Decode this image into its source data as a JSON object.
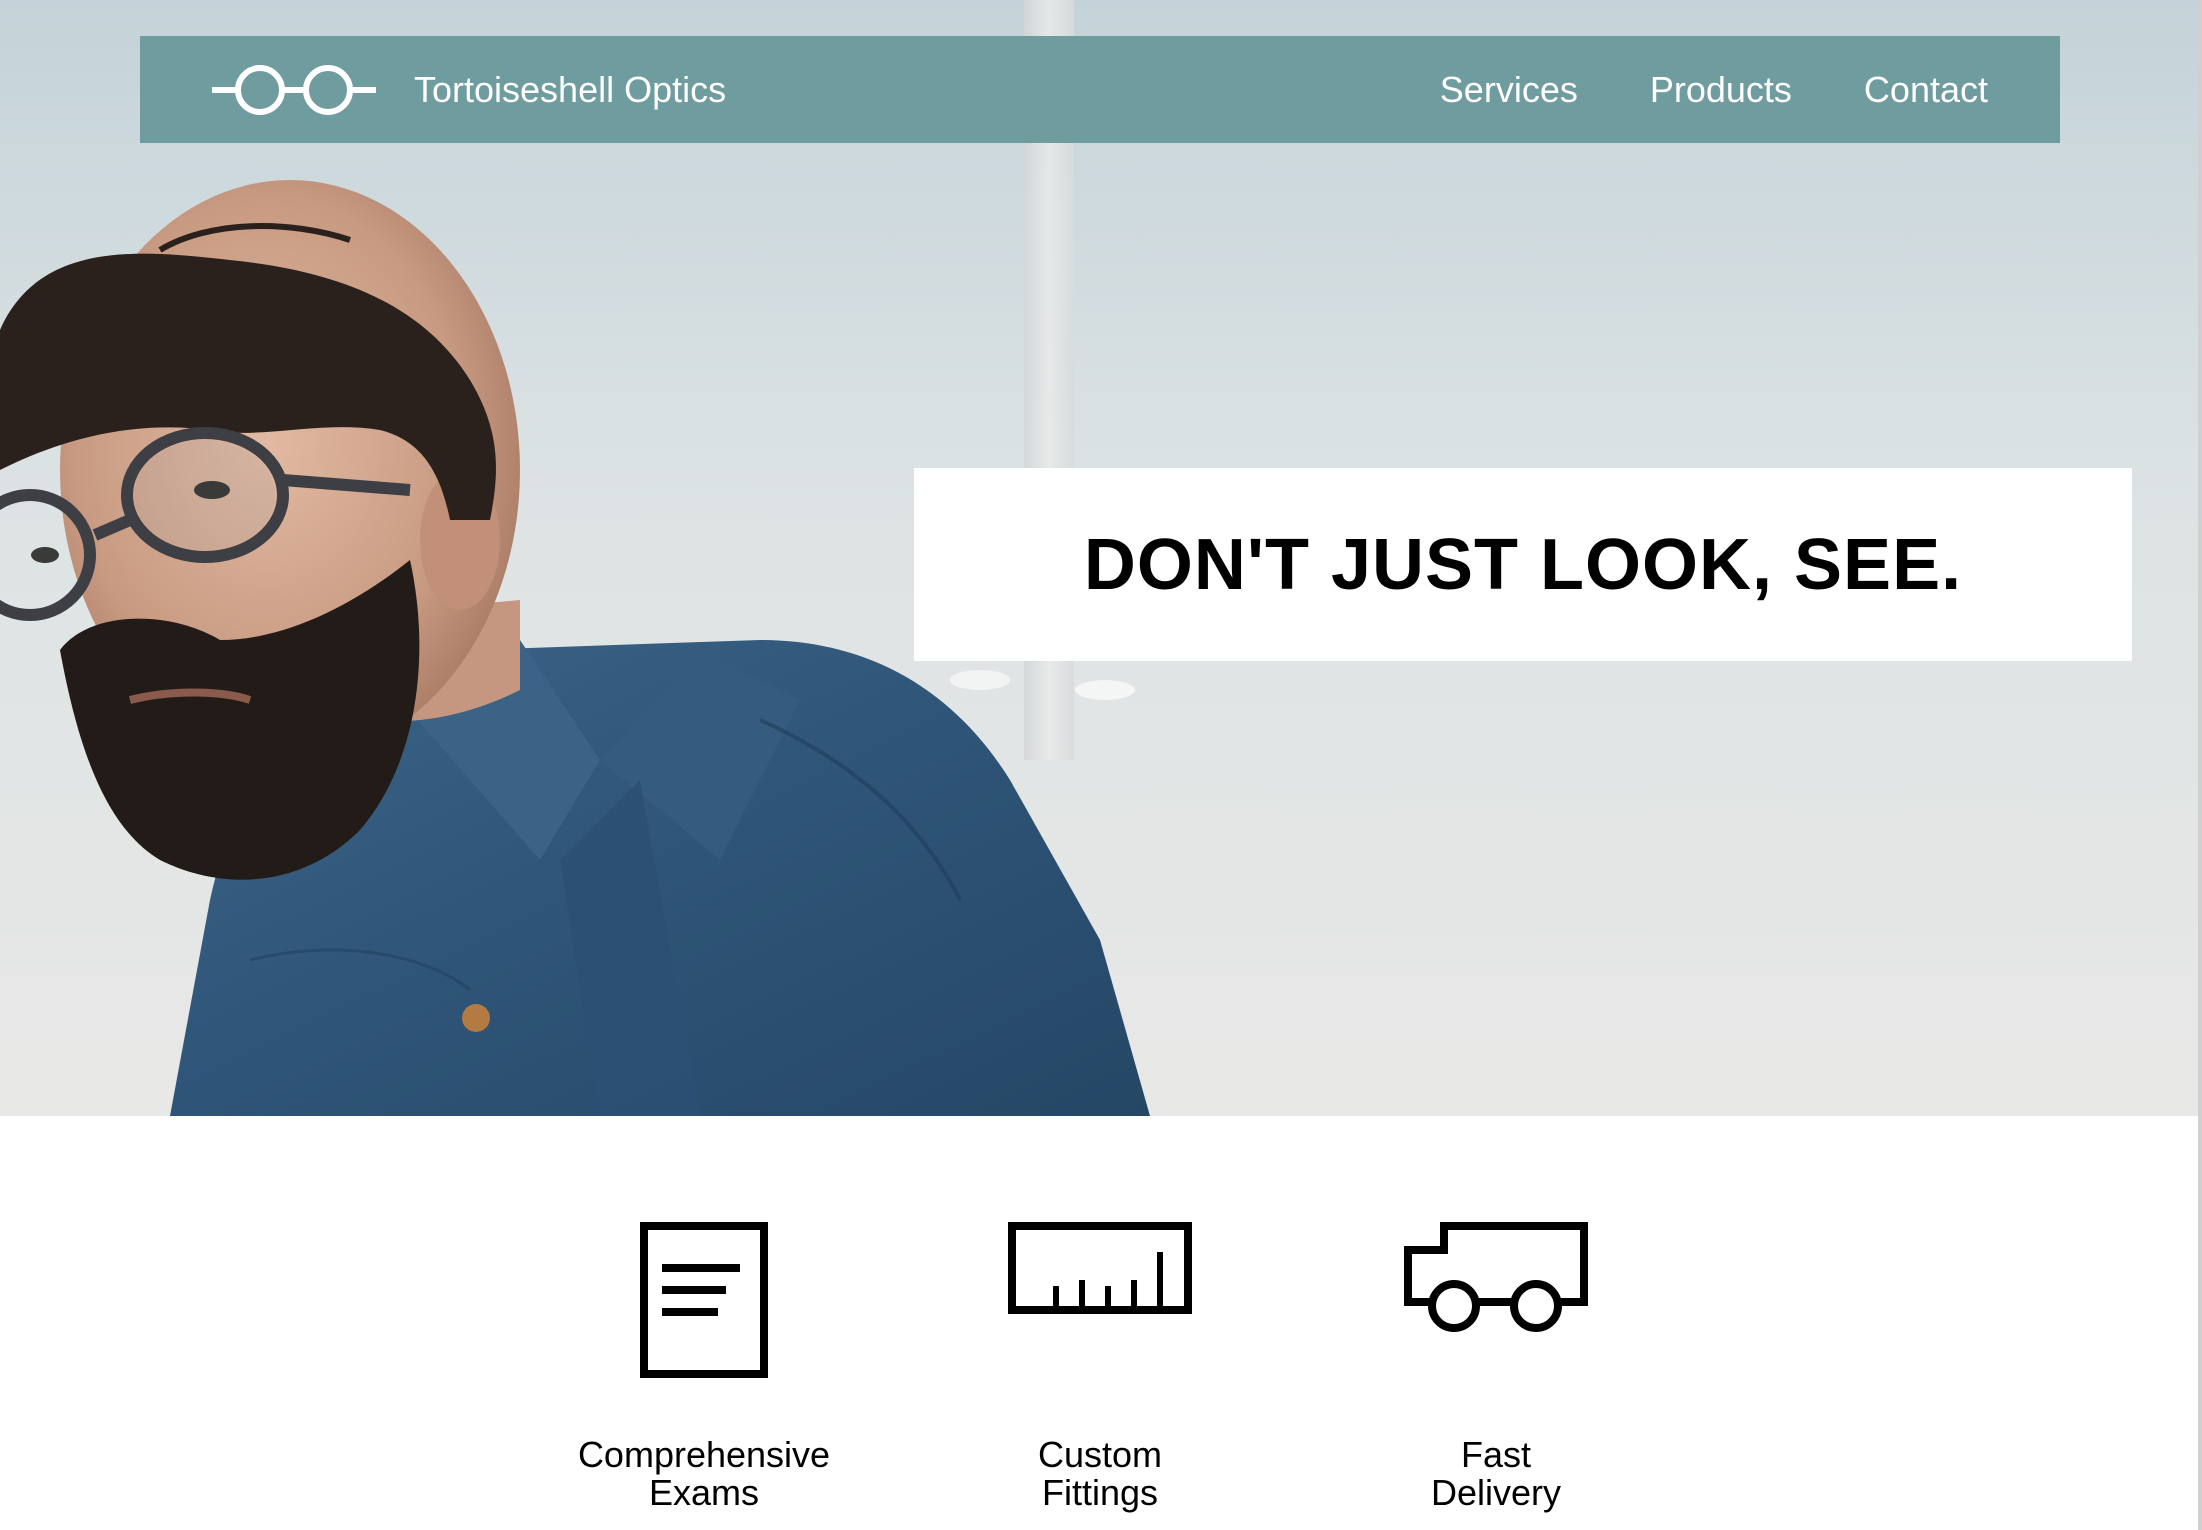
{
  "brand": {
    "name": "Tortoiseshell Optics",
    "logo_icon": "glasses-icon"
  },
  "nav": {
    "items": [
      {
        "label": "Services"
      },
      {
        "label": "Products"
      },
      {
        "label": "Contact"
      }
    ]
  },
  "hero": {
    "tagline": "DON'T JUST LOOK, SEE.",
    "image": "man-with-glasses-photo"
  },
  "features": [
    {
      "icon": "document-icon",
      "line1": "Comprehensive",
      "line2": "Exams"
    },
    {
      "icon": "ruler-icon",
      "line1": "Custom",
      "line2": "Fittings"
    },
    {
      "icon": "truck-icon",
      "line1": "Fast",
      "line2": "Delivery"
    }
  ],
  "colors": {
    "nav_background": "#6f9c9e",
    "nav_text": "#ffffff",
    "tagline_box": "#ffffff",
    "tagline_text": "#000000"
  }
}
